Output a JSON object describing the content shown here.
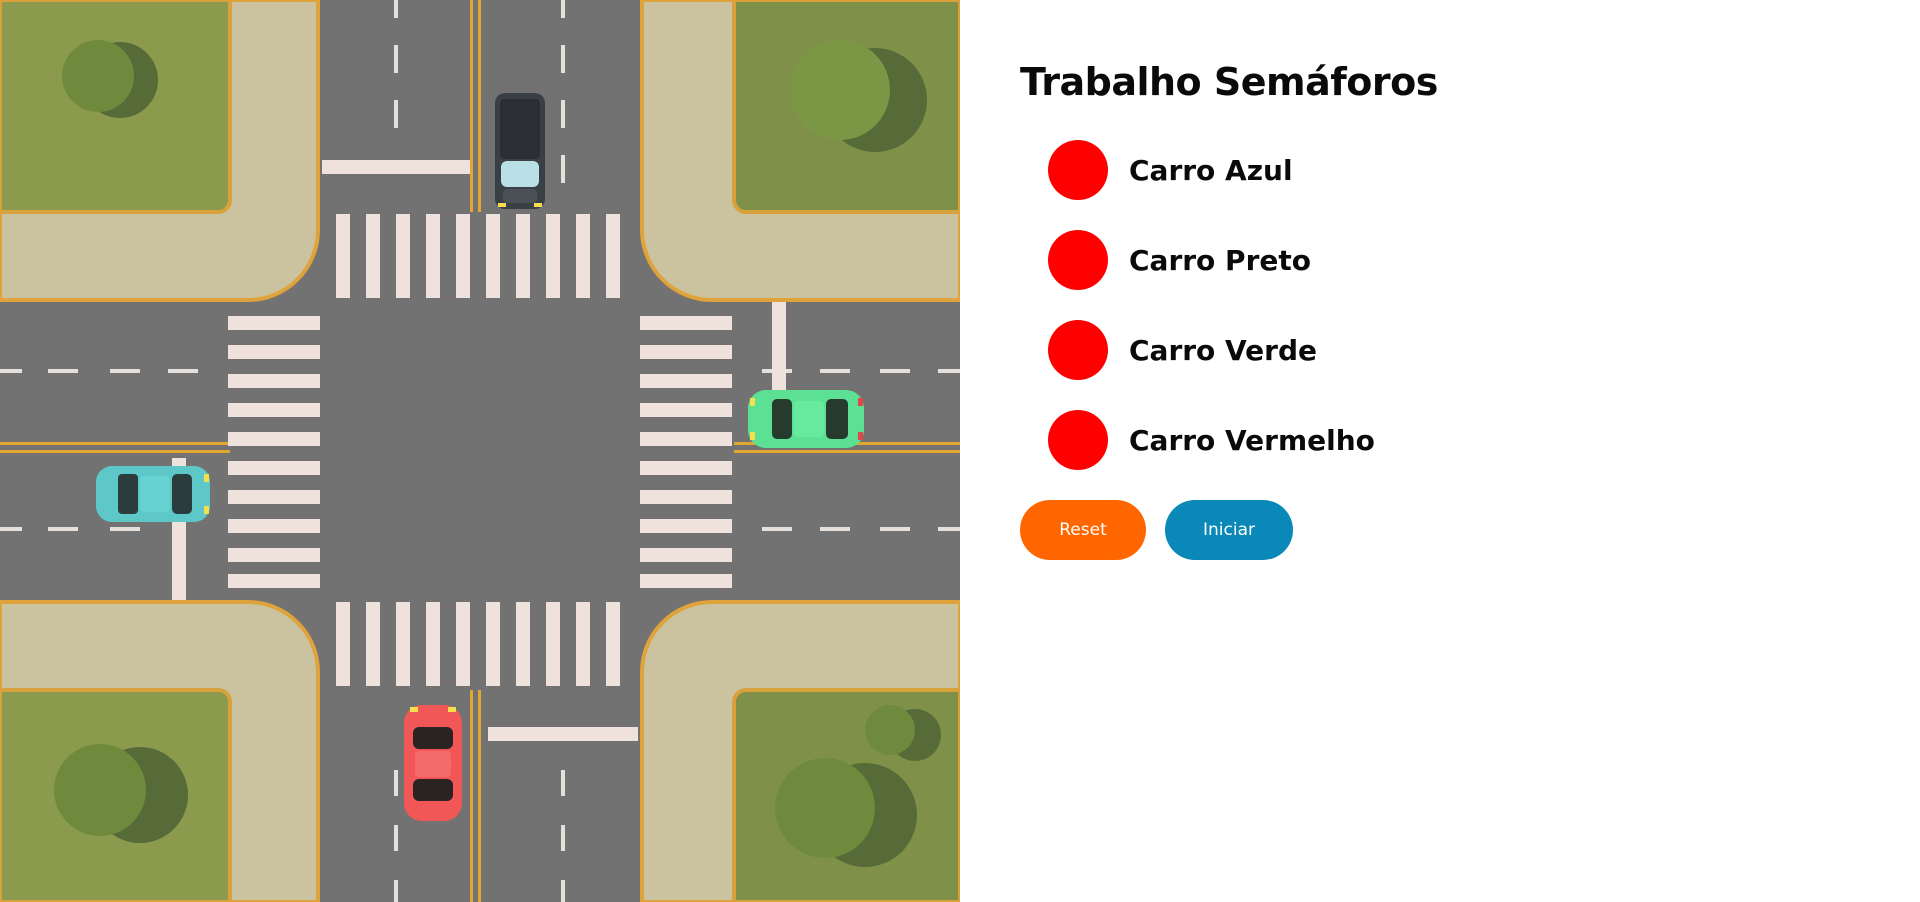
{
  "panel": {
    "title": "Trabalho Semáforos",
    "lights": [
      {
        "label": "Carro Azul",
        "color": "#ff0000"
      },
      {
        "label": "Carro Preto",
        "color": "#ff0000"
      },
      {
        "label": "Carro Verde",
        "color": "#ff0000"
      },
      {
        "label": "Carro Vermelho",
        "color": "#ff0000"
      }
    ],
    "buttons": {
      "reset": {
        "label": "Reset",
        "color": "#ff6600"
      },
      "start": {
        "label": "Iniciar",
        "color": "#0a88b8"
      }
    }
  },
  "scene": {
    "cars": [
      {
        "name": "blue-car",
        "color": "#5ec8c8"
      },
      {
        "name": "black-car",
        "color": "#3a3f45"
      },
      {
        "name": "green-car",
        "color": "#5ce094"
      },
      {
        "name": "red-car",
        "color": "#f25757"
      }
    ]
  }
}
